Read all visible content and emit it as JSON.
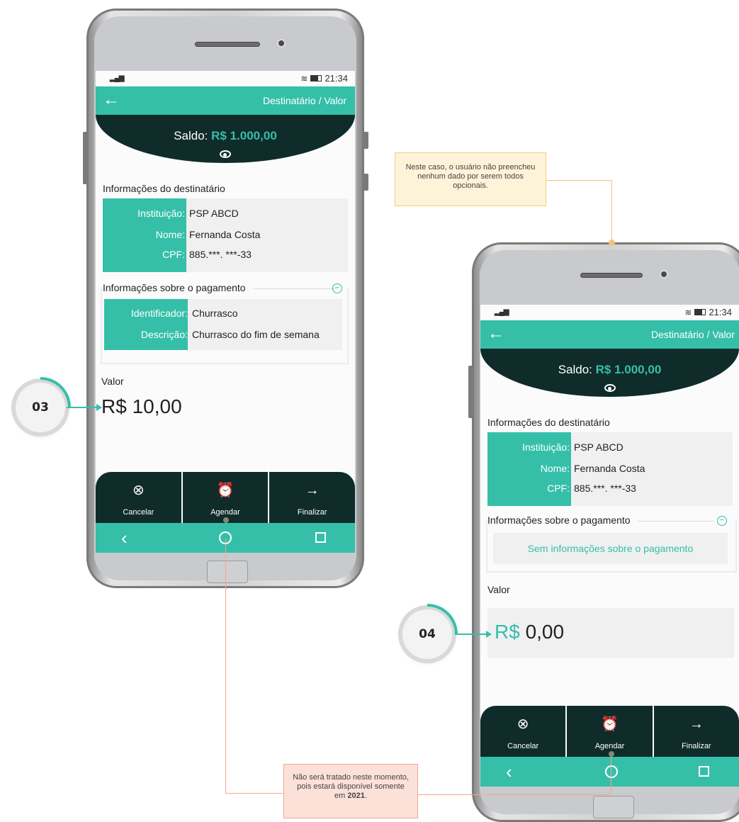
{
  "status": {
    "time": "21:34"
  },
  "appbar": {
    "back_icon": "arrow-left-icon",
    "title": "Destinatário / Valor"
  },
  "hero": {
    "saldo_label": "Saldo:",
    "saldo_value": "R$ 1.000,00",
    "eye_icon": "eye-icon"
  },
  "recipient": {
    "section_title": "Informações do destinatário",
    "rows": [
      {
        "key": "Instituição:",
        "value": "PSP ABCD"
      },
      {
        "key": "Nome:",
        "value": "Fernanda Costa"
      },
      {
        "key": "CPF:",
        "value": "885.***. ***-33"
      }
    ]
  },
  "payment": {
    "section_title": "Informações sobre o pagamento",
    "rows": [
      {
        "key": "Identificador:",
        "value": "Churrasco"
      },
      {
        "key": "Descrição:",
        "value": "Churrasco do fim de semana"
      }
    ],
    "empty_text": "Sem informações sobre o pagamento"
  },
  "valor": {
    "label": "Valor",
    "currency": "R$",
    "amount_phone1": "10,00",
    "amount_phone2": "0,00"
  },
  "actions": [
    {
      "label": "Cancelar",
      "icon": "cancel-circle-icon"
    },
    {
      "label": "Agendar",
      "icon": "alarm-clock-icon"
    },
    {
      "label": "Finalizar",
      "icon": "arrow-right-icon"
    }
  ],
  "badges": {
    "phone1": "03",
    "phone2": "04"
  },
  "notes": {
    "yellow": "Neste caso, o usuário não preencheu nenhum dado por serem todos opcionais.",
    "red_text": "Não será tratado neste momento, pois estará disponível somente em",
    "red_bold": "2021",
    "red_tail": "."
  },
  "colors": {
    "accent": "#35bfa9",
    "dark": "#0f2c2a"
  }
}
